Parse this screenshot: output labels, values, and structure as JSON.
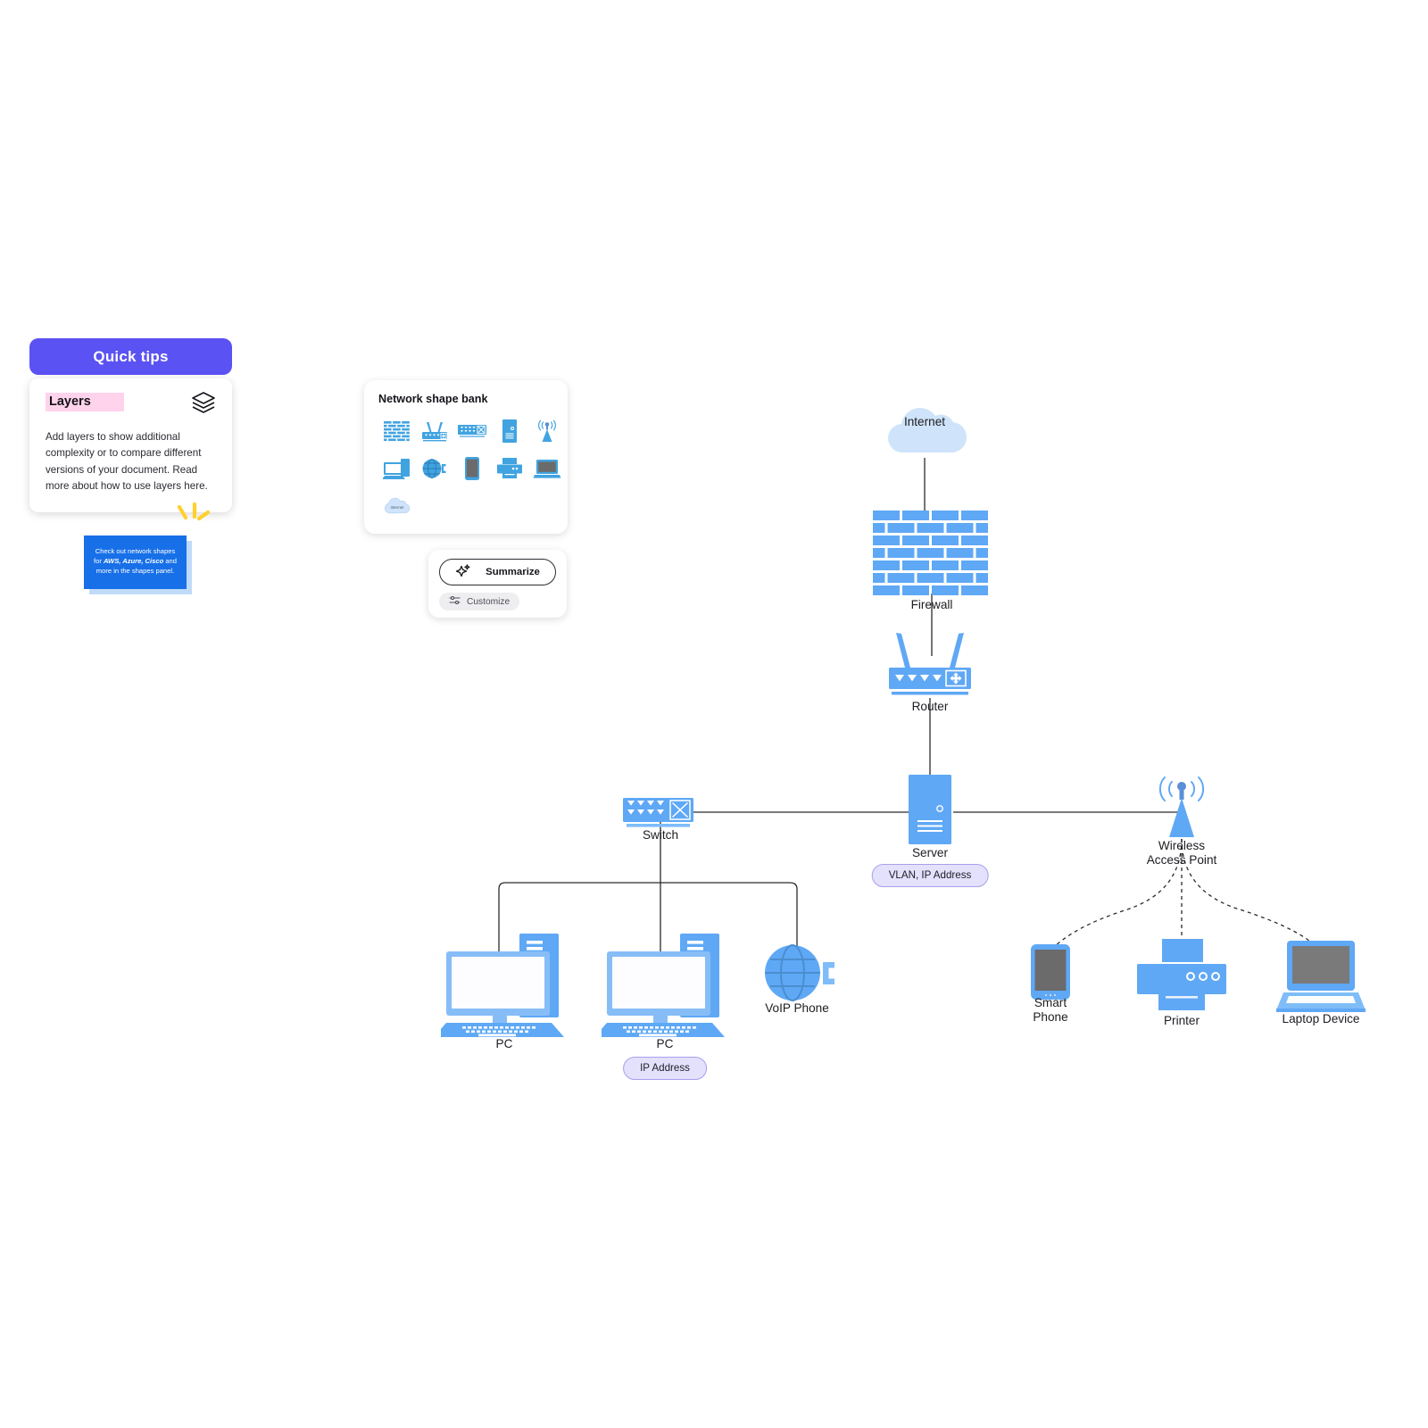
{
  "quick_tips": {
    "header": "Quick tips",
    "card_title": "Layers",
    "card_text": "Add layers to show additional complexity or to compare different versions of your document. Read more about how to use layers here.",
    "icon": "layers-icon",
    "header_color": "#5b52f3",
    "title_highlight_color": "#ffd3ec"
  },
  "sticky_note": {
    "text_before": "Check out network shapes for ",
    "brands": "AWS, Azure, Cisco",
    "text_after": " and more in the shapes panel.",
    "color": "#1770e8"
  },
  "shape_bank": {
    "title": "Network shape bank",
    "shapes": [
      {
        "name": "firewall-shape",
        "label": "Firewall"
      },
      {
        "name": "router-shape",
        "label": "Router"
      },
      {
        "name": "switch-shape",
        "label": "Switch"
      },
      {
        "name": "server-shape",
        "label": "Server"
      },
      {
        "name": "wireless-access-point-shape",
        "label": "Wireless Access Point"
      },
      {
        "name": "pc-shape",
        "label": "PC"
      },
      {
        "name": "voip-phone-shape",
        "label": "VoIP Phone"
      },
      {
        "name": "smart-phone-shape",
        "label": "Smart Phone"
      },
      {
        "name": "printer-shape",
        "label": "Printer"
      },
      {
        "name": "laptop-shape",
        "label": "Laptop Device"
      },
      {
        "name": "internet-cloud-shape",
        "label": "Internet"
      }
    ]
  },
  "summarize_panel": {
    "summarize_label": "Summarize",
    "customize_label": "Customize",
    "summarize_icon": "sparkle-icon",
    "customize_icon": "sliders-icon"
  },
  "diagram": {
    "accent_color": "#5fa8f5",
    "nodes": [
      {
        "id": "internet",
        "label": "Internet",
        "type": "cloud"
      },
      {
        "id": "firewall",
        "label": "Firewall",
        "type": "firewall"
      },
      {
        "id": "router",
        "label": "Router",
        "type": "router"
      },
      {
        "id": "switch",
        "label": "Switch",
        "type": "switch"
      },
      {
        "id": "server",
        "label": "Server",
        "type": "server",
        "tag": "VLAN, IP Address"
      },
      {
        "id": "wap",
        "label": "Wireless\nAccess Point",
        "type": "antenna"
      },
      {
        "id": "pc1",
        "label": "PC",
        "type": "pc"
      },
      {
        "id": "pc2",
        "label": "PC",
        "type": "pc",
        "tag": "IP Address"
      },
      {
        "id": "voip",
        "label": "VoIP Phone",
        "type": "voip"
      },
      {
        "id": "smartphone",
        "label": "Smart\nPhone",
        "type": "smartphone"
      },
      {
        "id": "printer",
        "label": "Printer",
        "type": "printer"
      },
      {
        "id": "laptop",
        "label": "Laptop Device",
        "type": "laptop"
      }
    ],
    "labels": {
      "internet": "Internet",
      "firewall": "Firewall",
      "router": "Router",
      "switch": "Switch",
      "server": "Server",
      "wap_line1": "Wireless",
      "wap_line2": "Access Point",
      "pc1": "PC",
      "pc2": "PC",
      "voip": "VoIP Phone",
      "smartphone_line1": "Smart",
      "smartphone_line2": "Phone",
      "printer": "Printer",
      "laptop": "Laptop Device",
      "server_tag": "VLAN, IP Address",
      "pc_tag": "IP Address",
      "cloud_text": "Internet"
    },
    "connections": [
      {
        "from": "internet",
        "to": "firewall",
        "style": "solid"
      },
      {
        "from": "firewall",
        "to": "router",
        "style": "solid"
      },
      {
        "from": "router",
        "to": "server",
        "style": "solid"
      },
      {
        "from": "switch",
        "to": "server",
        "style": "solid"
      },
      {
        "from": "server",
        "to": "wap",
        "style": "solid"
      },
      {
        "from": "switch",
        "to": "pc1",
        "style": "solid"
      },
      {
        "from": "switch",
        "to": "pc2",
        "style": "solid"
      },
      {
        "from": "switch",
        "to": "voip",
        "style": "solid"
      },
      {
        "from": "wap",
        "to": "smartphone",
        "style": "dashed"
      },
      {
        "from": "wap",
        "to": "printer",
        "style": "dashed"
      },
      {
        "from": "wap",
        "to": "laptop",
        "style": "dashed"
      }
    ]
  }
}
